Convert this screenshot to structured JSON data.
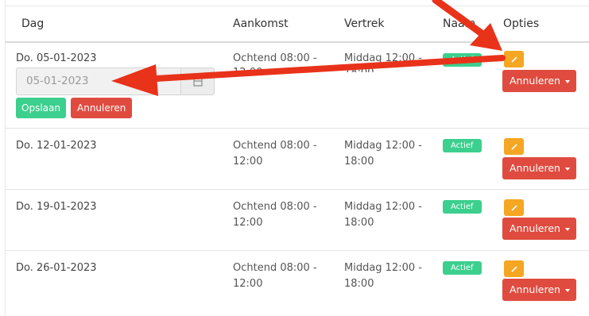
{
  "table": {
    "headers": {
      "day": "Dag",
      "arrival": "Aankomst",
      "departure": "Vertrek",
      "name": "Naam",
      "options": "Opties"
    },
    "rows": [
      {
        "day": "Do. 05-01-2023",
        "arrival_line1": "Ochtend 08:00 -",
        "arrival_line2": "12:00",
        "departure_line1": "Middag 12:00 -",
        "departure_line2": "18:00",
        "status": "Actief",
        "cancel_label": "Annuleren"
      },
      {
        "day": "Do. 12-01-2023",
        "arrival_line1": "Ochtend 08:00 -",
        "arrival_line2": "12:00",
        "departure_line1": "Middag 12:00 -",
        "departure_line2": "18:00",
        "status": "Actief",
        "cancel_label": "Annuleren"
      },
      {
        "day": "Do. 19-01-2023",
        "arrival_line1": "Ochtend 08:00 -",
        "arrival_line2": "12:00",
        "departure_line1": "Middag 12:00 -",
        "departure_line2": "18:00",
        "status": "Actief",
        "cancel_label": "Annuleren"
      },
      {
        "day": "Do. 26-01-2023",
        "arrival_line1": "Ochtend 08:00 -",
        "arrival_line2": "12:00",
        "departure_line1": "Middag 12:00 -",
        "departure_line2": "18:00",
        "status": "Actief",
        "cancel_label": "Annuleren"
      }
    ]
  },
  "edit_form": {
    "date_value": "05-01-2023",
    "save_label": "Opslaan",
    "cancel_label": "Annuleren"
  },
  "icons": {
    "edit": "pencil-icon",
    "calendar": "calendar-icon",
    "caret": "caret-down-icon"
  },
  "colors": {
    "status_active": "#3ccf8e",
    "edit_button": "#f5a623",
    "cancel_button": "#e04b3f",
    "annotation_arrow": "#e8321a"
  }
}
